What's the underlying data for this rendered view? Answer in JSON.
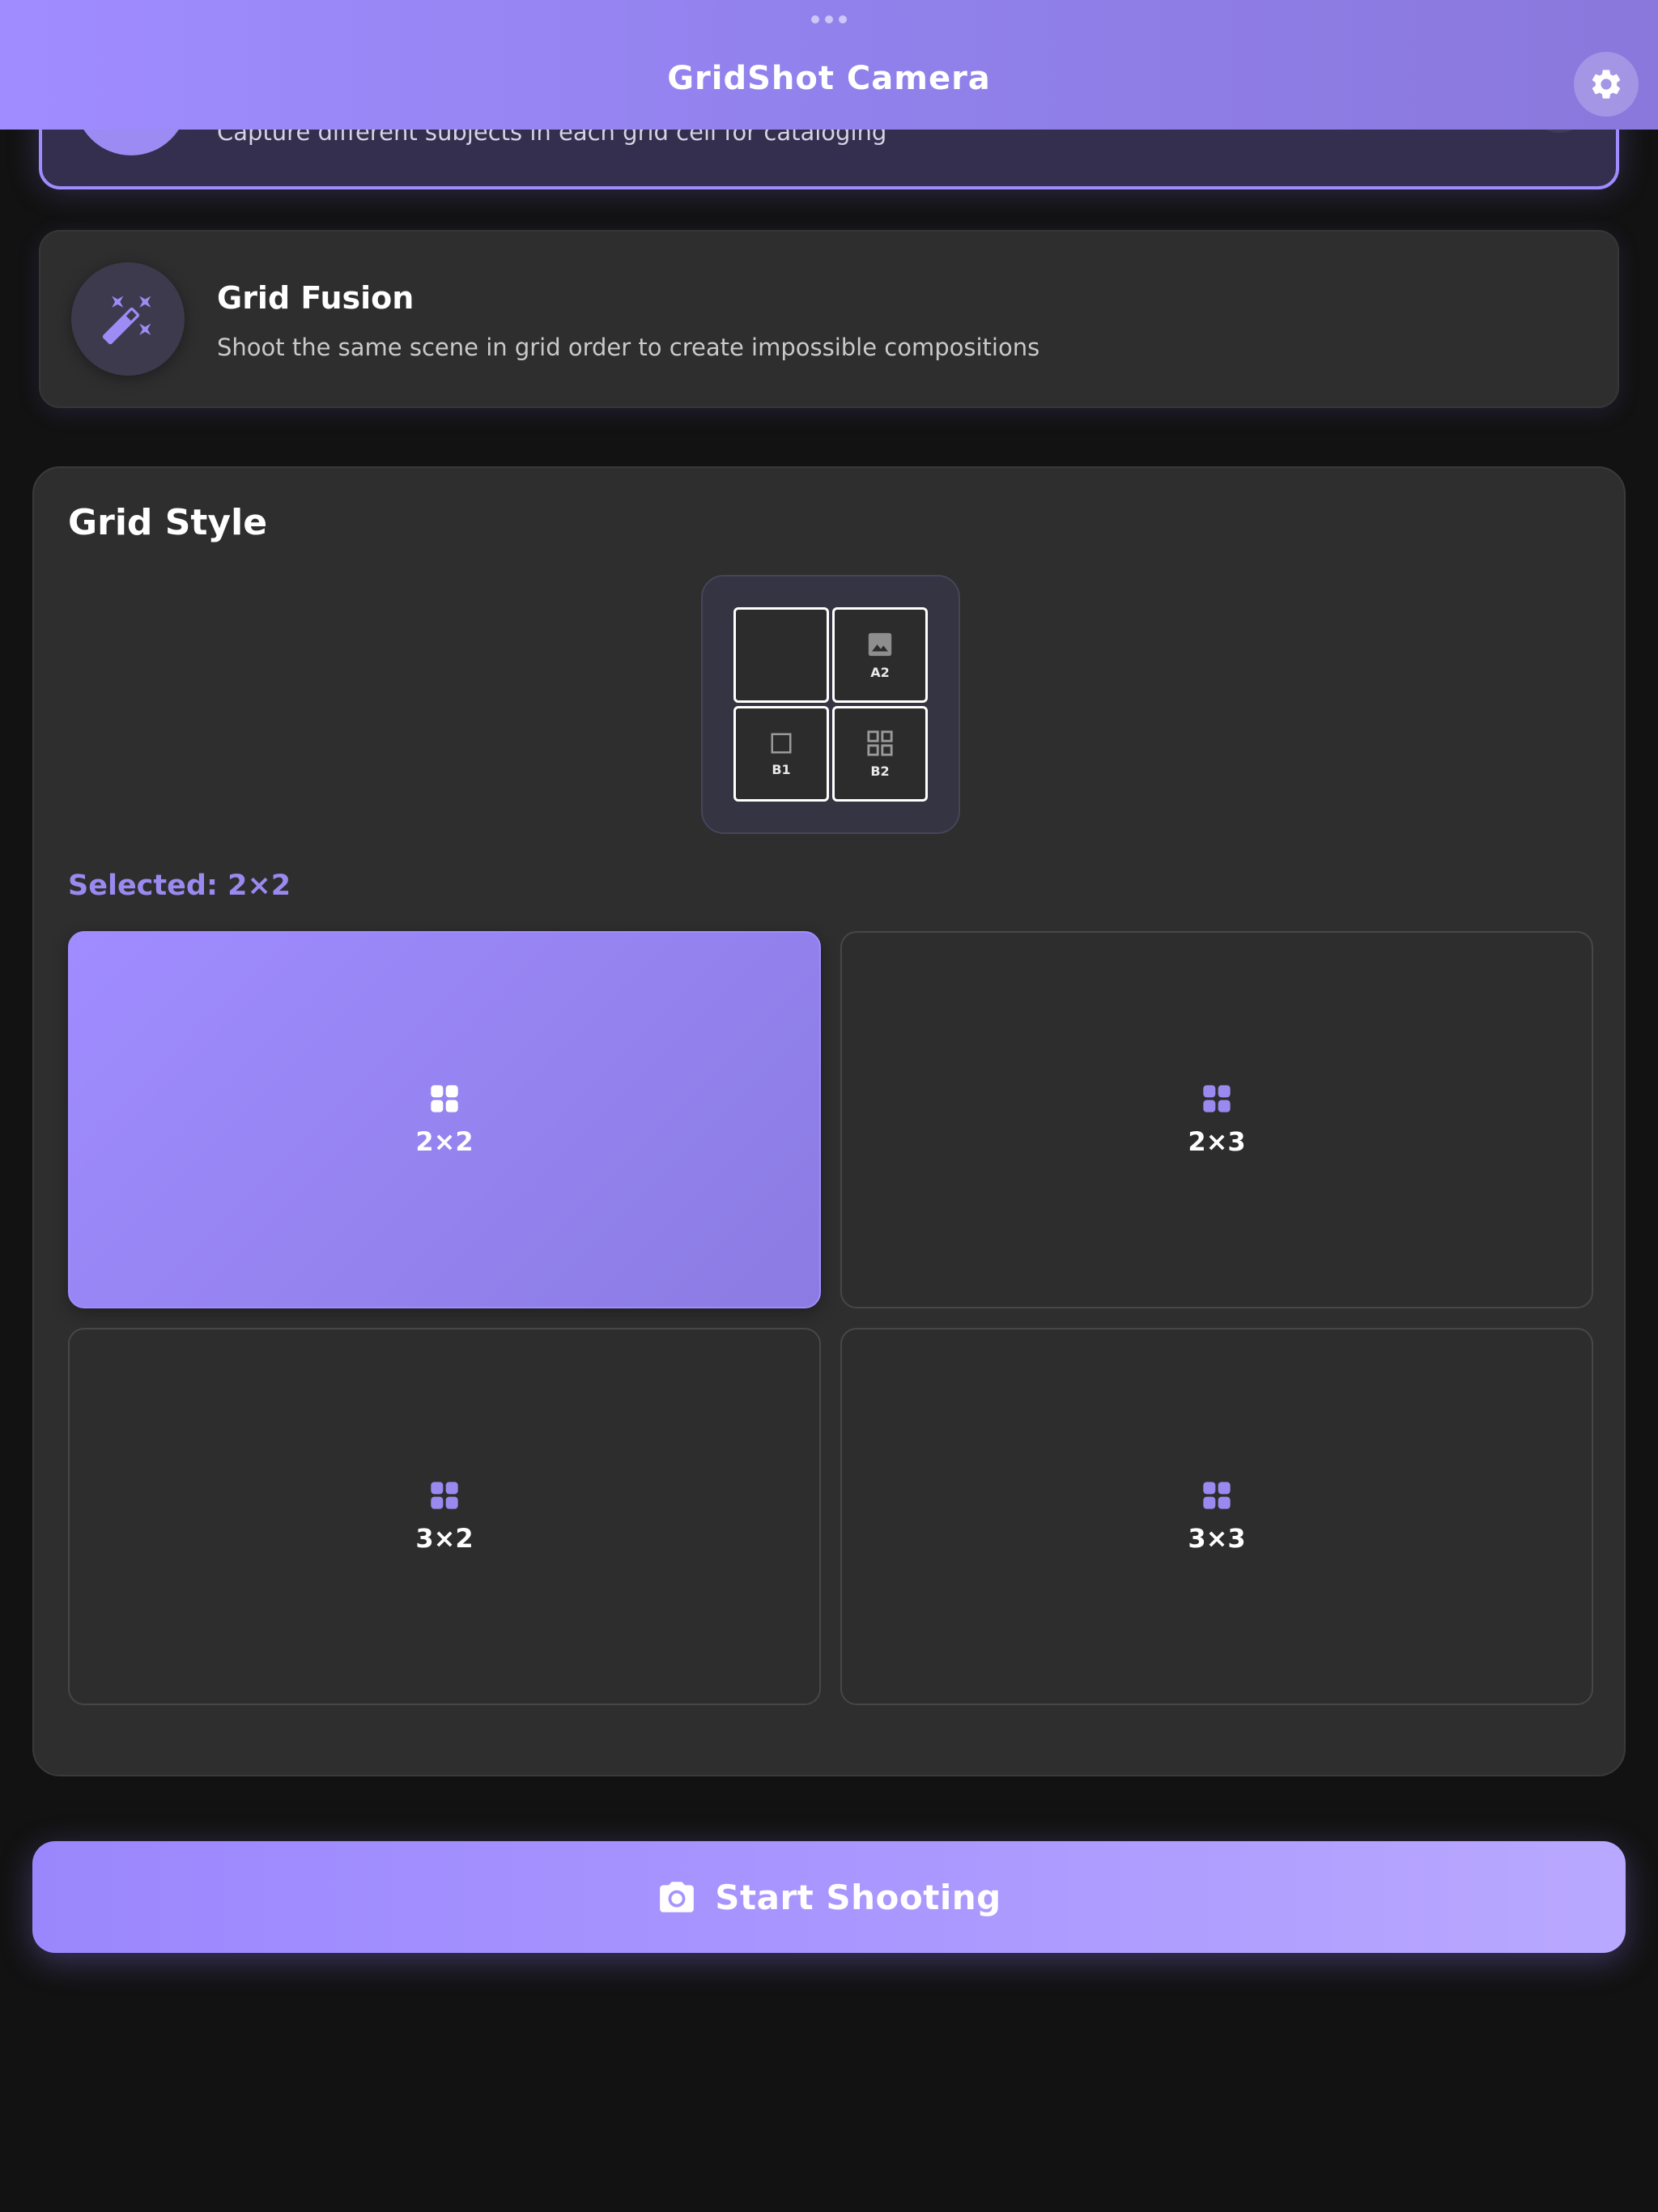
{
  "header": {
    "title": "GridShot Camera",
    "settings_icon": "gear-icon"
  },
  "modes": {
    "top": {
      "description": "Capture different subjects in each grid cell for cataloging"
    },
    "fusion": {
      "name": "Grid Fusion",
      "description": "Shoot the same scene in grid order to create impossible compositions",
      "icon": "magic-wand-icon"
    }
  },
  "grid_style": {
    "title": "Grid Style",
    "preview": {
      "cells": [
        {
          "label": "",
          "icon": "empty"
        },
        {
          "label": "A2",
          "icon": "image-icon"
        },
        {
          "label": "B1",
          "icon": "square-icon"
        },
        {
          "label": "B2",
          "icon": "grid-icon"
        }
      ]
    },
    "selected_label": "Selected: 2×2",
    "options": [
      {
        "label": "2×2",
        "selected": true
      },
      {
        "label": "2×3",
        "selected": false
      },
      {
        "label": "3×2",
        "selected": false
      },
      {
        "label": "3×3",
        "selected": false
      }
    ]
  },
  "start_button": {
    "label": "Start Shooting",
    "icon": "camera-icon"
  },
  "colors": {
    "accent": "#a08cff",
    "background": "#121212",
    "card": "#2e2e2e"
  }
}
